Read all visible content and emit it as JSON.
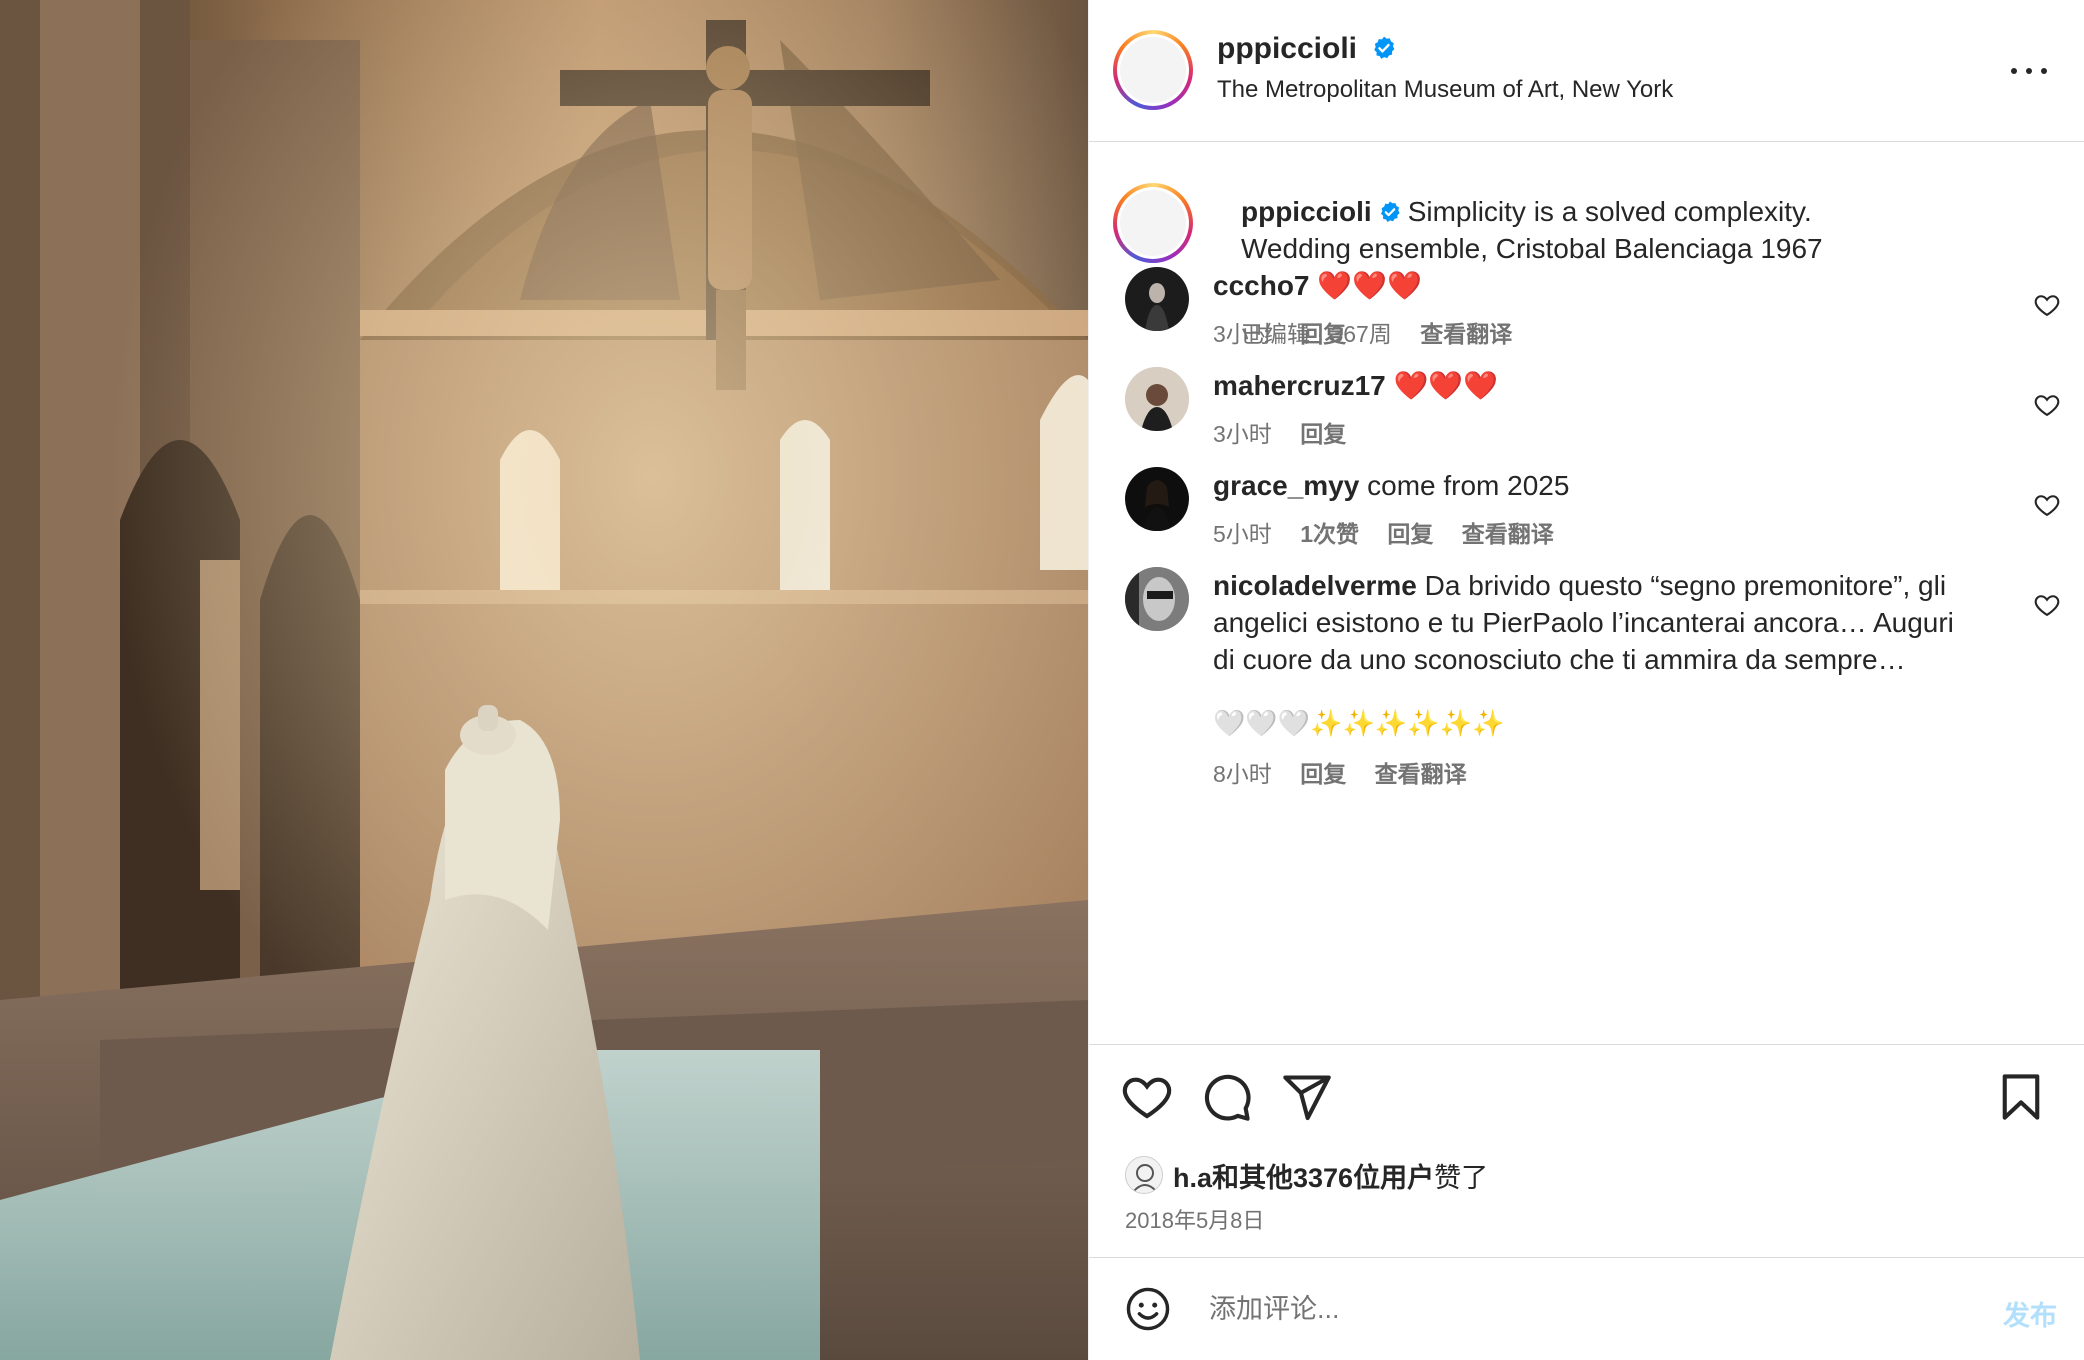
{
  "post": {
    "username": "pppiccioli",
    "location": "The Metropolitan Museum of Art, New York",
    "caption_line1": "Simplicity is a solved complexity.",
    "caption_line2": "Wedding ensemble, Cristobal Balenciaga 1967",
    "caption_meta": "已编辑 · 367周",
    "translate_label": "查看翻译"
  },
  "comments": [
    {
      "username": "cccho7",
      "text": "❤️❤️❤️",
      "time": "3小时",
      "likes": "",
      "reply": "回复",
      "translate": ""
    },
    {
      "username": "mahercruz17",
      "text": "❤️❤️❤️",
      "time": "3小时",
      "likes": "",
      "reply": "回复",
      "translate": ""
    },
    {
      "username": "grace_myy",
      "text": "come from 2025",
      "time": "5小时",
      "likes": "1次赞",
      "reply": "回复",
      "translate": "查看翻译"
    },
    {
      "username": "nicoladelverme",
      "text": "Da brivido questo “segno premonitore”, gli angelici esistono e tu PierPaolo l’incanterai ancora… Auguri di cuore da uno sconosciuto che ti ammira da sempre…",
      "emojis": "🤍🤍🤍✨✨✨✨✨✨",
      "time": "8小时",
      "likes": "",
      "reply": "回复",
      "translate": "查看翻译"
    }
  ],
  "likes": {
    "text": "h.a和其他3376位用户",
    "suffix": "赞了"
  },
  "date": "2018年5月8日",
  "composer": {
    "placeholder": "添加评论...",
    "post_label": "发布"
  },
  "colors": {
    "verified": "#0095f6",
    "post_disabled": "#b2dffc",
    "secondary_text": "#737373"
  },
  "icons": [
    "heart-icon",
    "comment-icon",
    "share-icon",
    "bookmark-icon",
    "more-icon",
    "emoji-icon",
    "verified-badge-icon"
  ]
}
